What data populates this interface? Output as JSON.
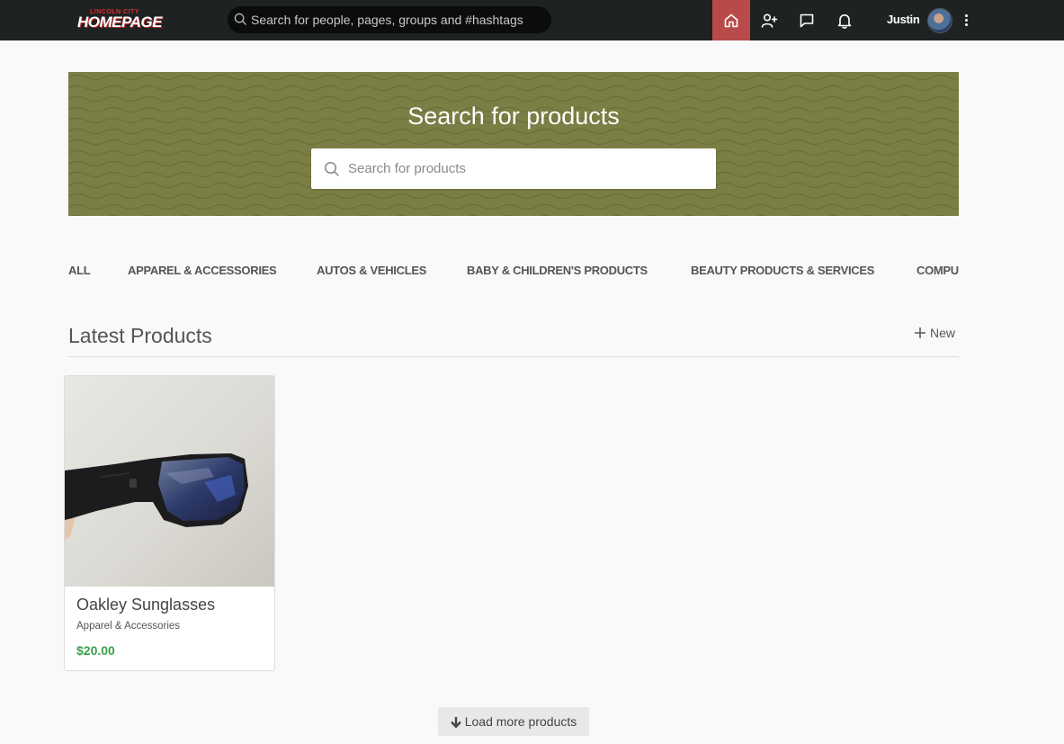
{
  "header": {
    "logo_tagline": "LINCOLN CITY",
    "logo_wordmark": "HOMEPAGE",
    "search_placeholder": "Search for people, pages, groups and #hashtags",
    "nav_icons": [
      "home-icon",
      "add-friend-icon",
      "messages-icon",
      "notifications-icon"
    ],
    "active_icon": "home-icon",
    "user_name": "Justin"
  },
  "hero": {
    "title": "Search for products",
    "search_placeholder": "Search for products"
  },
  "categories": [
    {
      "label": "ALL",
      "active": true
    },
    {
      "label": "APPAREL & ACCESSORIES",
      "active": false
    },
    {
      "label": "AUTOS & VEHICLES",
      "active": false
    },
    {
      "label": "BABY & CHILDREN'S PRODUCTS",
      "active": false
    },
    {
      "label": "BEAUTY PRODUCTS & SERVICES",
      "active": false
    },
    {
      "label": "COMPU",
      "active": false
    }
  ],
  "section": {
    "title": "Latest Products",
    "new_label": "New"
  },
  "products": [
    {
      "name": "Oakley Sunglasses",
      "category": "Apparel & Accessories",
      "price": "$20.00"
    }
  ],
  "load_more_label": "Load more products",
  "colors": {
    "topbar": "#1f2222",
    "active_nav": "#b94a4a",
    "hero_bg": "#7b7f45",
    "active_category": "#2f8fd0",
    "price": "#3aa04a"
  }
}
